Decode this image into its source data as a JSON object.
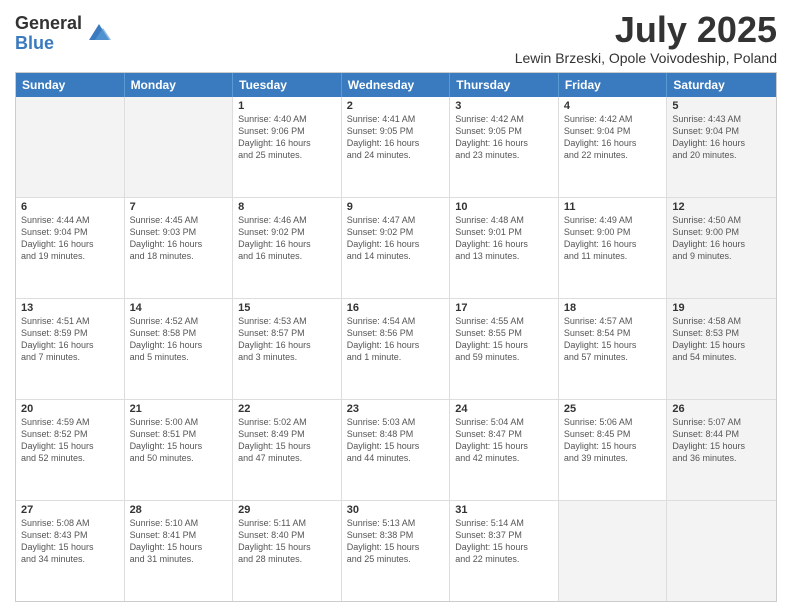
{
  "logo": {
    "general": "General",
    "blue": "Blue"
  },
  "title": "July 2025",
  "location": "Lewin Brzeski, Opole Voivodeship, Poland",
  "days_of_week": [
    "Sunday",
    "Monday",
    "Tuesday",
    "Wednesday",
    "Thursday",
    "Friday",
    "Saturday"
  ],
  "weeks": [
    [
      {
        "day": "",
        "info": "",
        "shaded": true
      },
      {
        "day": "",
        "info": "",
        "shaded": true
      },
      {
        "day": "1",
        "info": "Sunrise: 4:40 AM\nSunset: 9:06 PM\nDaylight: 16 hours\nand 25 minutes."
      },
      {
        "day": "2",
        "info": "Sunrise: 4:41 AM\nSunset: 9:05 PM\nDaylight: 16 hours\nand 24 minutes."
      },
      {
        "day": "3",
        "info": "Sunrise: 4:42 AM\nSunset: 9:05 PM\nDaylight: 16 hours\nand 23 minutes."
      },
      {
        "day": "4",
        "info": "Sunrise: 4:42 AM\nSunset: 9:04 PM\nDaylight: 16 hours\nand 22 minutes."
      },
      {
        "day": "5",
        "info": "Sunrise: 4:43 AM\nSunset: 9:04 PM\nDaylight: 16 hours\nand 20 minutes.",
        "shaded": true
      }
    ],
    [
      {
        "day": "6",
        "info": "Sunrise: 4:44 AM\nSunset: 9:04 PM\nDaylight: 16 hours\nand 19 minutes."
      },
      {
        "day": "7",
        "info": "Sunrise: 4:45 AM\nSunset: 9:03 PM\nDaylight: 16 hours\nand 18 minutes."
      },
      {
        "day": "8",
        "info": "Sunrise: 4:46 AM\nSunset: 9:02 PM\nDaylight: 16 hours\nand 16 minutes."
      },
      {
        "day": "9",
        "info": "Sunrise: 4:47 AM\nSunset: 9:02 PM\nDaylight: 16 hours\nand 14 minutes."
      },
      {
        "day": "10",
        "info": "Sunrise: 4:48 AM\nSunset: 9:01 PM\nDaylight: 16 hours\nand 13 minutes."
      },
      {
        "day": "11",
        "info": "Sunrise: 4:49 AM\nSunset: 9:00 PM\nDaylight: 16 hours\nand 11 minutes."
      },
      {
        "day": "12",
        "info": "Sunrise: 4:50 AM\nSunset: 9:00 PM\nDaylight: 16 hours\nand 9 minutes.",
        "shaded": true
      }
    ],
    [
      {
        "day": "13",
        "info": "Sunrise: 4:51 AM\nSunset: 8:59 PM\nDaylight: 16 hours\nand 7 minutes."
      },
      {
        "day": "14",
        "info": "Sunrise: 4:52 AM\nSunset: 8:58 PM\nDaylight: 16 hours\nand 5 minutes."
      },
      {
        "day": "15",
        "info": "Sunrise: 4:53 AM\nSunset: 8:57 PM\nDaylight: 16 hours\nand 3 minutes."
      },
      {
        "day": "16",
        "info": "Sunrise: 4:54 AM\nSunset: 8:56 PM\nDaylight: 16 hours\nand 1 minute."
      },
      {
        "day": "17",
        "info": "Sunrise: 4:55 AM\nSunset: 8:55 PM\nDaylight: 15 hours\nand 59 minutes."
      },
      {
        "day": "18",
        "info": "Sunrise: 4:57 AM\nSunset: 8:54 PM\nDaylight: 15 hours\nand 57 minutes."
      },
      {
        "day": "19",
        "info": "Sunrise: 4:58 AM\nSunset: 8:53 PM\nDaylight: 15 hours\nand 54 minutes.",
        "shaded": true
      }
    ],
    [
      {
        "day": "20",
        "info": "Sunrise: 4:59 AM\nSunset: 8:52 PM\nDaylight: 15 hours\nand 52 minutes."
      },
      {
        "day": "21",
        "info": "Sunrise: 5:00 AM\nSunset: 8:51 PM\nDaylight: 15 hours\nand 50 minutes."
      },
      {
        "day": "22",
        "info": "Sunrise: 5:02 AM\nSunset: 8:49 PM\nDaylight: 15 hours\nand 47 minutes."
      },
      {
        "day": "23",
        "info": "Sunrise: 5:03 AM\nSunset: 8:48 PM\nDaylight: 15 hours\nand 44 minutes."
      },
      {
        "day": "24",
        "info": "Sunrise: 5:04 AM\nSunset: 8:47 PM\nDaylight: 15 hours\nand 42 minutes."
      },
      {
        "day": "25",
        "info": "Sunrise: 5:06 AM\nSunset: 8:45 PM\nDaylight: 15 hours\nand 39 minutes."
      },
      {
        "day": "26",
        "info": "Sunrise: 5:07 AM\nSunset: 8:44 PM\nDaylight: 15 hours\nand 36 minutes.",
        "shaded": true
      }
    ],
    [
      {
        "day": "27",
        "info": "Sunrise: 5:08 AM\nSunset: 8:43 PM\nDaylight: 15 hours\nand 34 minutes."
      },
      {
        "day": "28",
        "info": "Sunrise: 5:10 AM\nSunset: 8:41 PM\nDaylight: 15 hours\nand 31 minutes."
      },
      {
        "day": "29",
        "info": "Sunrise: 5:11 AM\nSunset: 8:40 PM\nDaylight: 15 hours\nand 28 minutes."
      },
      {
        "day": "30",
        "info": "Sunrise: 5:13 AM\nSunset: 8:38 PM\nDaylight: 15 hours\nand 25 minutes."
      },
      {
        "day": "31",
        "info": "Sunrise: 5:14 AM\nSunset: 8:37 PM\nDaylight: 15 hours\nand 22 minutes."
      },
      {
        "day": "",
        "info": "",
        "shaded": true
      },
      {
        "day": "",
        "info": "",
        "shaded": true
      }
    ]
  ]
}
